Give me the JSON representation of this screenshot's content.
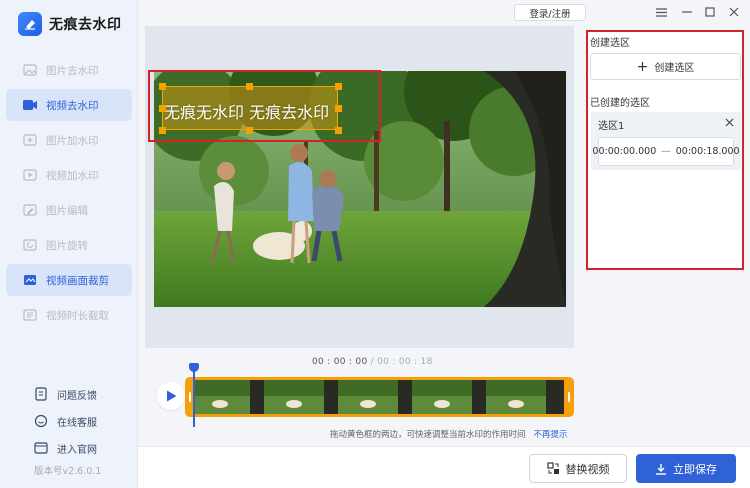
{
  "app": {
    "name": "无痕去水印",
    "version": "版本号v2.6.0.1"
  },
  "topbar": {
    "login_label": "登录/注册"
  },
  "sidebar": {
    "items": [
      {
        "label": "图片去水印",
        "active": false
      },
      {
        "label": "视频去水印",
        "active": true
      },
      {
        "label": "图片加水印",
        "active": false
      },
      {
        "label": "视频加水印",
        "active": false
      },
      {
        "label": "图片编辑",
        "active": false
      },
      {
        "label": "图片旋转",
        "active": false
      },
      {
        "label": "视频画面裁剪",
        "active": true
      },
      {
        "label": "视频时长截取",
        "active": false
      }
    ],
    "bottom_links": [
      {
        "label": "问题反馈",
        "icon": "feedback-icon"
      },
      {
        "label": "在线客服",
        "icon": "chat-icon"
      },
      {
        "label": "进入官网",
        "icon": "website-icon"
      }
    ]
  },
  "preview": {
    "watermark_text": "无痕无水印  无痕去水印"
  },
  "timeline": {
    "current": "00 : 00 : 00",
    "separator": " / ",
    "total": "00 : 00 : 18",
    "progress": 0.0,
    "hint": "拖动黄色框的两边，可快速调整当前水印的作用时间",
    "hint_link": "不再提示"
  },
  "actions": {
    "replace_label": "替换视频",
    "save_label": "立即保存"
  },
  "right_panel": {
    "create_title": "创建选区",
    "create_button": "创建选区",
    "created_title": "已创建的选区",
    "regions": [
      {
        "name": "选区1",
        "start": "00:00:00.000",
        "dash": "—",
        "end": "00:00:18.000"
      }
    ]
  },
  "colors": {
    "primary": "#2e62d6",
    "highlight_red": "#d3222a",
    "timeline_orange": "#f59f0b"
  }
}
